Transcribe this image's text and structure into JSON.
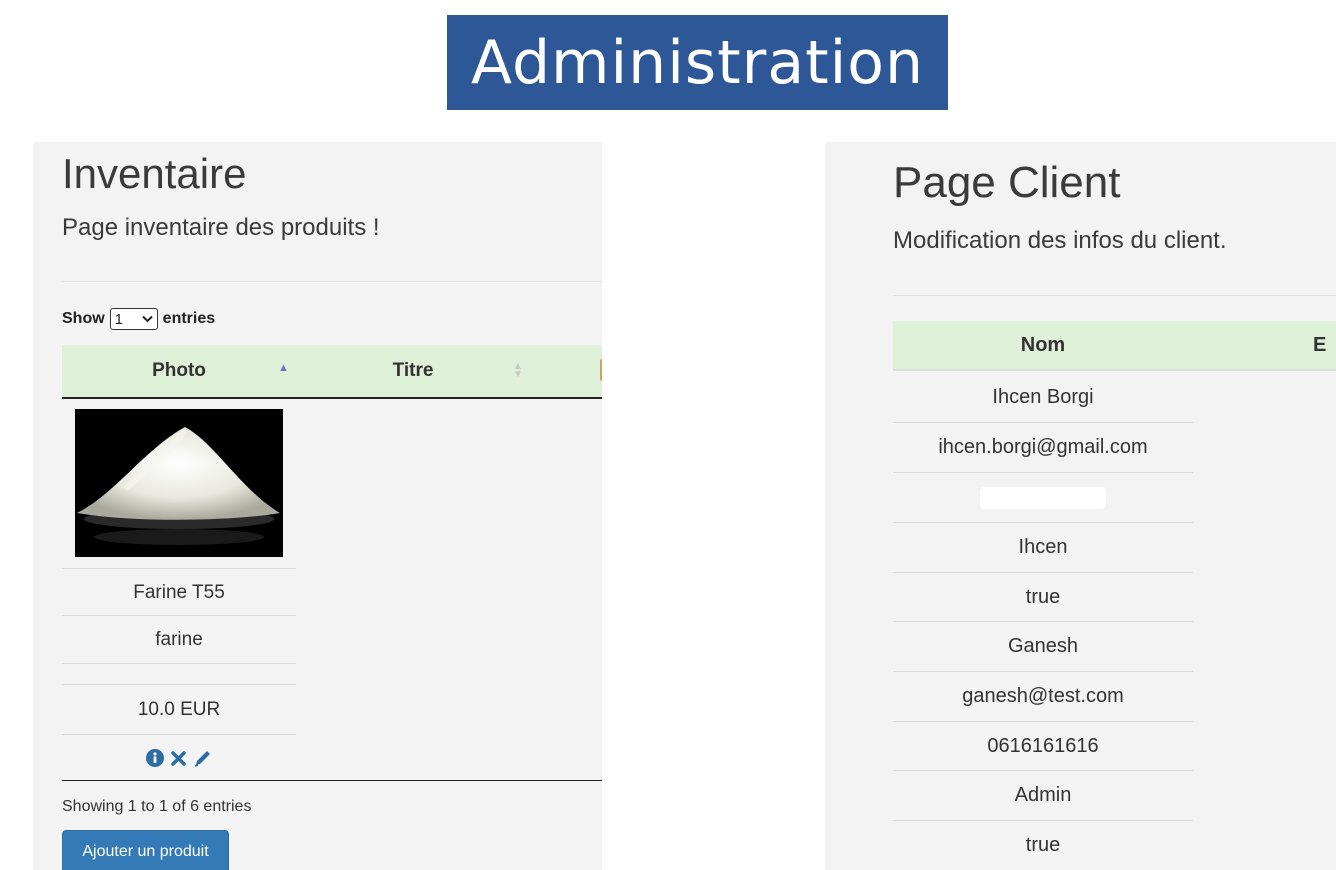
{
  "banner": {
    "title": "Administration"
  },
  "inventory": {
    "title": "Inventaire",
    "subtitle": "Page inventaire des produits !",
    "length_menu": {
      "prefix": "Show",
      "selected": "1",
      "suffix": "entries"
    },
    "columns": [
      "Photo",
      "Titre"
    ],
    "row": {
      "image_alt": "flour pile",
      "title": "Farine T55",
      "category": "farine",
      "description": "",
      "price": "10.0 EUR",
      "actions": [
        "info-icon",
        "delete-icon",
        "edit-icon"
      ]
    },
    "info": "Showing 1 to 1 of 6 entries",
    "add_button": "Ajouter un produit"
  },
  "client": {
    "title": "Page Client",
    "subtitle": "Modification des infos du client.",
    "columns": [
      "Nom",
      "E"
    ],
    "values": [
      "Ihcen Borgi",
      "ihcen.borgi@gmail.com",
      "",
      "Ihcen",
      "true",
      "Ganesh",
      "ganesh@test.com",
      "0616161616",
      "Admin",
      "true"
    ]
  },
  "colors": {
    "banner_bg": "#2e5797",
    "header_bg": "#dff0d8",
    "button_bg": "#337ab7",
    "icon_blue": "#2e6da4"
  }
}
